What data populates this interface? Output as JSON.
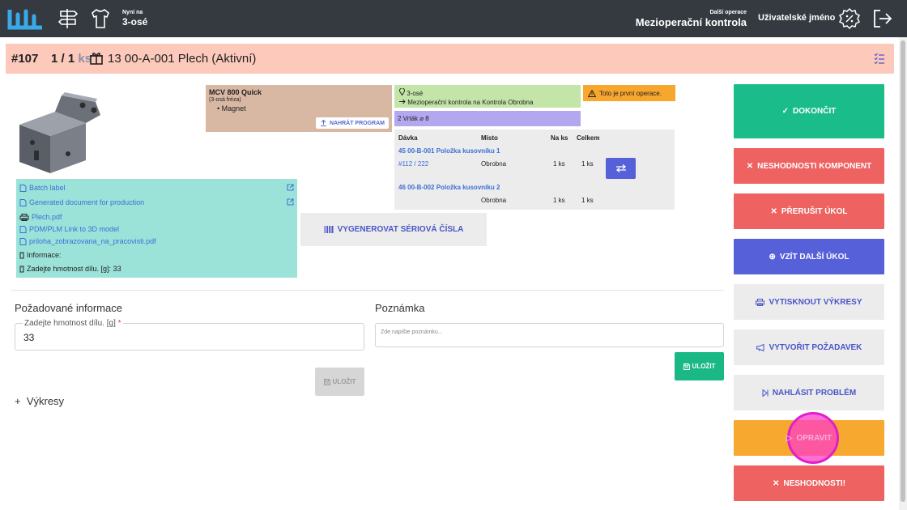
{
  "topbar": {
    "now_on_label": "Nyní na",
    "now_on_value": "3-osé",
    "next_op_label": "Další operace",
    "next_op_value": "Mezioperační kontrola",
    "username": "Uživatelské jméno"
  },
  "header": {
    "order": "#107",
    "qty": "1 / 1",
    "unit": "ks",
    "part": "13 00-A-001 Plech (Aktivní)"
  },
  "docs": {
    "batch_label": "Batch label",
    "generated_doc": "Generated document for production",
    "pdf": "Plech.pdf",
    "pdm_link": "PDM/PLM Link to 3D model",
    "attachment": "priloha_zobrazovana_na_pracovisti.pdf",
    "info_label": "Informace:",
    "info_weight": "Zadejte hmotnost dílu. [g]: 33"
  },
  "machine": {
    "name": "MCV 800 Quick",
    "type": "(3-osá fréza)",
    "item": "Magnet",
    "upload_label": "NAHRÁT PROGRAM"
  },
  "location": {
    "line1": "3-osé",
    "line2": "Mezioperační kontrola na Kontrola Obrobna"
  },
  "warning": "Toto je první operace.",
  "drill": "2 Vrták ⌀ 8",
  "batch": {
    "headers": [
      "Dávka",
      "Místo",
      "Na ks",
      "Celkem"
    ],
    "row1_title": "45 00-B-001 Položka kusovníku 1",
    "row1_ref": "#112 / 222",
    "row1_place": "Obrobna",
    "row1_per": "1 ks",
    "row1_total": "1 ks",
    "row2_title": "46 00-B-002 Položka kusovníku 2",
    "row2_place": "Obrobna",
    "row2_per": "1 ks",
    "row2_total": "1 ks"
  },
  "generate_serials": "VYGENEROVAT SÉRIOVÁ ČÍSLA",
  "required_info": {
    "title": "Požadované informace",
    "field_label": "Zadejte hmotnost dílu. [g]",
    "field_required_mark": "*",
    "field_value": "33",
    "save_label": "ULOŽIT"
  },
  "note": {
    "title": "Poznámka",
    "placeholder": "Zde napište poznámku...",
    "save_label": "ULOŽIT"
  },
  "drawings": {
    "toggle": "+",
    "label": "Výkresy"
  },
  "actions": {
    "finish": "DOKONČIT",
    "component_nonconformity": "NESHODNOSTI KOMPONENT",
    "interrupt": "PŘERUŠIT ÚKOL",
    "take_next": "VZÍT DALŠÍ ÚKOL",
    "print_drawings": "VYTISKNOUT VÝKRESY",
    "create_request": "VYTVOŘIT POŽADAVEK",
    "report_problem": "NAHLÁSIT PROBLÉM",
    "repair": "OPRAVIT",
    "nonconformities": "NESHODNOSTI!"
  },
  "colors": {
    "topbar": "#343a40",
    "header": "#fcc9bb",
    "green": "#1abc8a",
    "red": "#ee6262",
    "blue": "#5660d8",
    "orange": "#f7a82e",
    "teal_panel": "#9be3d9"
  }
}
